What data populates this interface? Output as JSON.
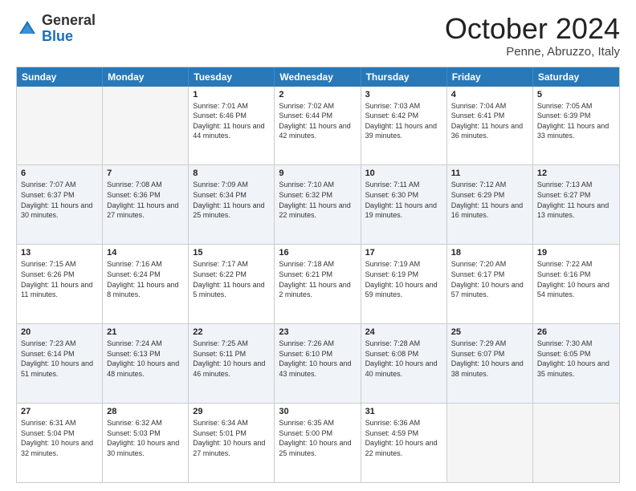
{
  "header": {
    "logo": {
      "general": "General",
      "blue": "Blue"
    },
    "title": "October 2024",
    "location": "Penne, Abruzzo, Italy"
  },
  "calendar": {
    "days_of_week": [
      "Sunday",
      "Monday",
      "Tuesday",
      "Wednesday",
      "Thursday",
      "Friday",
      "Saturday"
    ],
    "weeks": [
      [
        {
          "day": "",
          "empty": true
        },
        {
          "day": "",
          "empty": true
        },
        {
          "day": "1",
          "sunrise": "7:01 AM",
          "sunset": "6:46 PM",
          "daylight": "11 hours and 44 minutes."
        },
        {
          "day": "2",
          "sunrise": "7:02 AM",
          "sunset": "6:44 PM",
          "daylight": "11 hours and 42 minutes."
        },
        {
          "day": "3",
          "sunrise": "7:03 AM",
          "sunset": "6:42 PM",
          "daylight": "11 hours and 39 minutes."
        },
        {
          "day": "4",
          "sunrise": "7:04 AM",
          "sunset": "6:41 PM",
          "daylight": "11 hours and 36 minutes."
        },
        {
          "day": "5",
          "sunrise": "7:05 AM",
          "sunset": "6:39 PM",
          "daylight": "11 hours and 33 minutes."
        }
      ],
      [
        {
          "day": "6",
          "sunrise": "7:07 AM",
          "sunset": "6:37 PM",
          "daylight": "11 hours and 30 minutes."
        },
        {
          "day": "7",
          "sunrise": "7:08 AM",
          "sunset": "6:36 PM",
          "daylight": "11 hours and 27 minutes."
        },
        {
          "day": "8",
          "sunrise": "7:09 AM",
          "sunset": "6:34 PM",
          "daylight": "11 hours and 25 minutes."
        },
        {
          "day": "9",
          "sunrise": "7:10 AM",
          "sunset": "6:32 PM",
          "daylight": "11 hours and 22 minutes."
        },
        {
          "day": "10",
          "sunrise": "7:11 AM",
          "sunset": "6:30 PM",
          "daylight": "11 hours and 19 minutes."
        },
        {
          "day": "11",
          "sunrise": "7:12 AM",
          "sunset": "6:29 PM",
          "daylight": "11 hours and 16 minutes."
        },
        {
          "day": "12",
          "sunrise": "7:13 AM",
          "sunset": "6:27 PM",
          "daylight": "11 hours and 13 minutes."
        }
      ],
      [
        {
          "day": "13",
          "sunrise": "7:15 AM",
          "sunset": "6:26 PM",
          "daylight": "11 hours and 11 minutes."
        },
        {
          "day": "14",
          "sunrise": "7:16 AM",
          "sunset": "6:24 PM",
          "daylight": "11 hours and 8 minutes."
        },
        {
          "day": "15",
          "sunrise": "7:17 AM",
          "sunset": "6:22 PM",
          "daylight": "11 hours and 5 minutes."
        },
        {
          "day": "16",
          "sunrise": "7:18 AM",
          "sunset": "6:21 PM",
          "daylight": "11 hours and 2 minutes."
        },
        {
          "day": "17",
          "sunrise": "7:19 AM",
          "sunset": "6:19 PM",
          "daylight": "10 hours and 59 minutes."
        },
        {
          "day": "18",
          "sunrise": "7:20 AM",
          "sunset": "6:17 PM",
          "daylight": "10 hours and 57 minutes."
        },
        {
          "day": "19",
          "sunrise": "7:22 AM",
          "sunset": "6:16 PM",
          "daylight": "10 hours and 54 minutes."
        }
      ],
      [
        {
          "day": "20",
          "sunrise": "7:23 AM",
          "sunset": "6:14 PM",
          "daylight": "10 hours and 51 minutes."
        },
        {
          "day": "21",
          "sunrise": "7:24 AM",
          "sunset": "6:13 PM",
          "daylight": "10 hours and 48 minutes."
        },
        {
          "day": "22",
          "sunrise": "7:25 AM",
          "sunset": "6:11 PM",
          "daylight": "10 hours and 46 minutes."
        },
        {
          "day": "23",
          "sunrise": "7:26 AM",
          "sunset": "6:10 PM",
          "daylight": "10 hours and 43 minutes."
        },
        {
          "day": "24",
          "sunrise": "7:28 AM",
          "sunset": "6:08 PM",
          "daylight": "10 hours and 40 minutes."
        },
        {
          "day": "25",
          "sunrise": "7:29 AM",
          "sunset": "6:07 PM",
          "daylight": "10 hours and 38 minutes."
        },
        {
          "day": "26",
          "sunrise": "7:30 AM",
          "sunset": "6:05 PM",
          "daylight": "10 hours and 35 minutes."
        }
      ],
      [
        {
          "day": "27",
          "sunrise": "6:31 AM",
          "sunset": "5:04 PM",
          "daylight": "10 hours and 32 minutes."
        },
        {
          "day": "28",
          "sunrise": "6:32 AM",
          "sunset": "5:03 PM",
          "daylight": "10 hours and 30 minutes."
        },
        {
          "day": "29",
          "sunrise": "6:34 AM",
          "sunset": "5:01 PM",
          "daylight": "10 hours and 27 minutes."
        },
        {
          "day": "30",
          "sunrise": "6:35 AM",
          "sunset": "5:00 PM",
          "daylight": "10 hours and 25 minutes."
        },
        {
          "day": "31",
          "sunrise": "6:36 AM",
          "sunset": "4:59 PM",
          "daylight": "10 hours and 22 minutes."
        },
        {
          "day": "",
          "empty": true
        },
        {
          "day": "",
          "empty": true
        }
      ]
    ]
  }
}
